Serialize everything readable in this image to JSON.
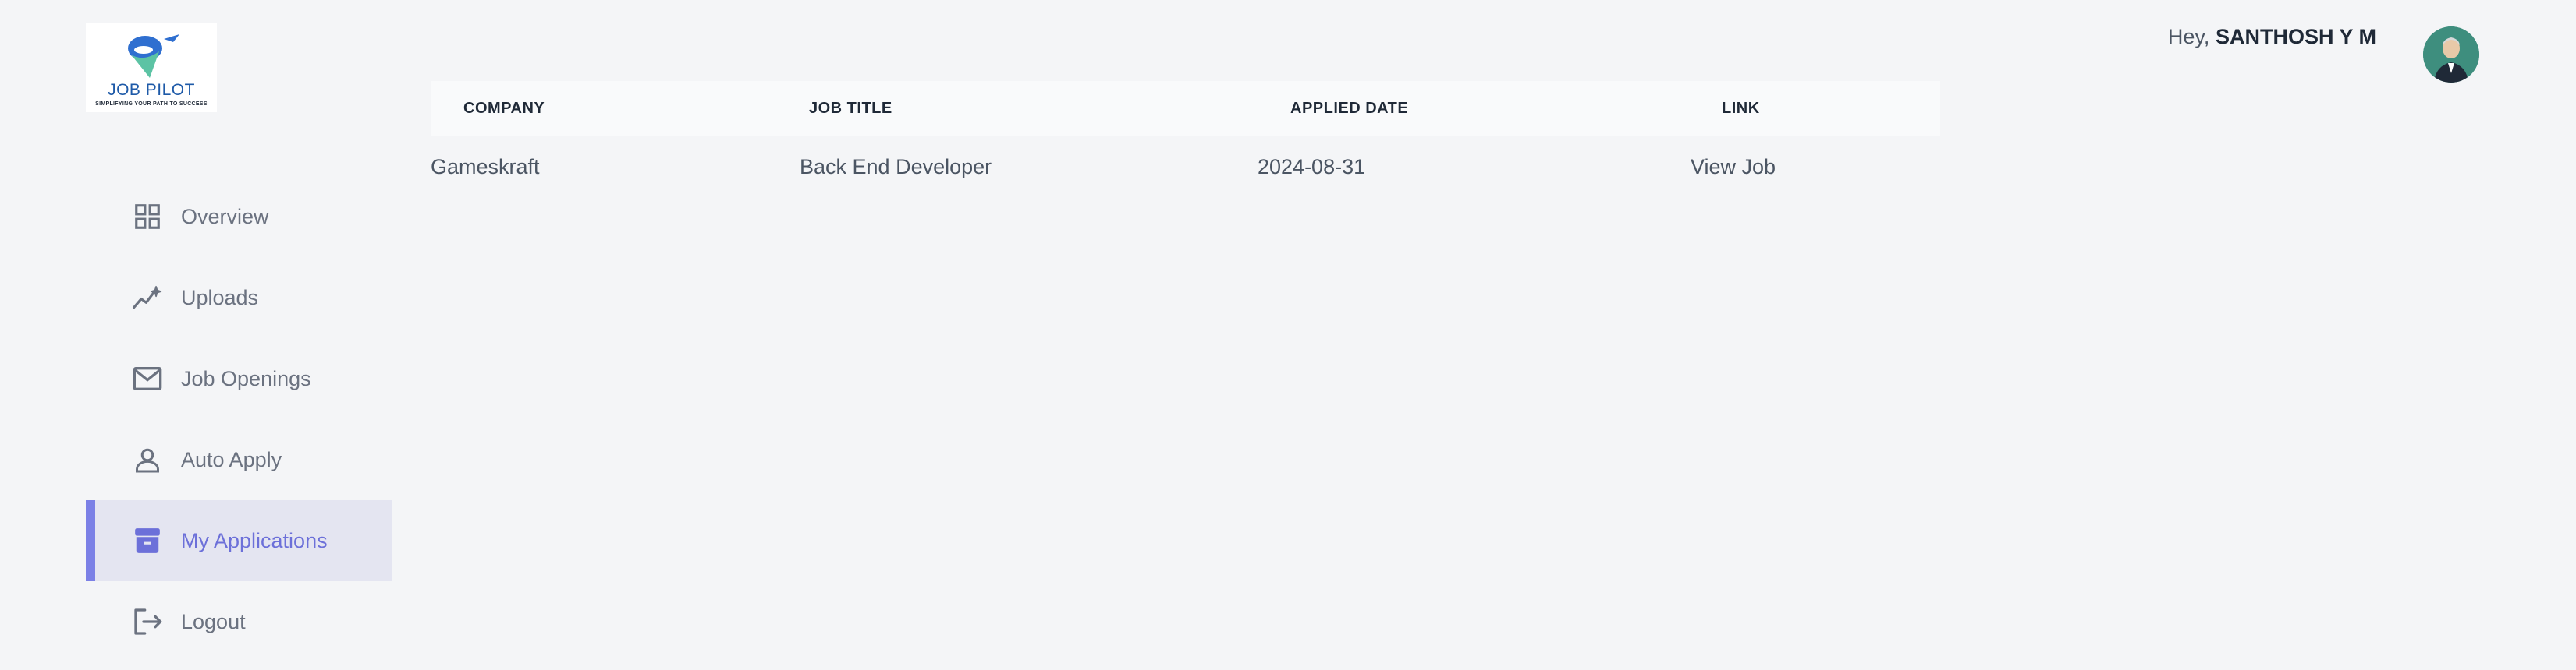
{
  "brand": {
    "name": "JOB PILOT",
    "tagline": "SIMPLIFYING YOUR PATH TO SUCCESS"
  },
  "header": {
    "greeting": "Hey,",
    "user_name": "SANTHOSH Y M"
  },
  "sidebar": {
    "items": [
      {
        "label": "Overview",
        "icon": "grid-icon",
        "active": false
      },
      {
        "label": "Uploads",
        "icon": "sparkle-chart-icon",
        "active": false
      },
      {
        "label": "Job Openings",
        "icon": "mail-icon",
        "active": false
      },
      {
        "label": "Auto Apply",
        "icon": "user-icon",
        "active": false
      },
      {
        "label": "My Applications",
        "icon": "archive-icon",
        "active": true
      },
      {
        "label": "Logout",
        "icon": "logout-icon",
        "active": false
      }
    ]
  },
  "table": {
    "columns": [
      "COMPANY",
      "JOB TITLE",
      "APPLIED DATE",
      "LINK"
    ],
    "rows": [
      {
        "company": "Gameskraft",
        "job_title": "Back End Developer",
        "applied_date": "2024-08-31",
        "link": "View Job"
      }
    ]
  },
  "colors": {
    "accent": "#7b80e6",
    "active_bg": "#e4e5f1",
    "background": "#f4f5f7"
  }
}
